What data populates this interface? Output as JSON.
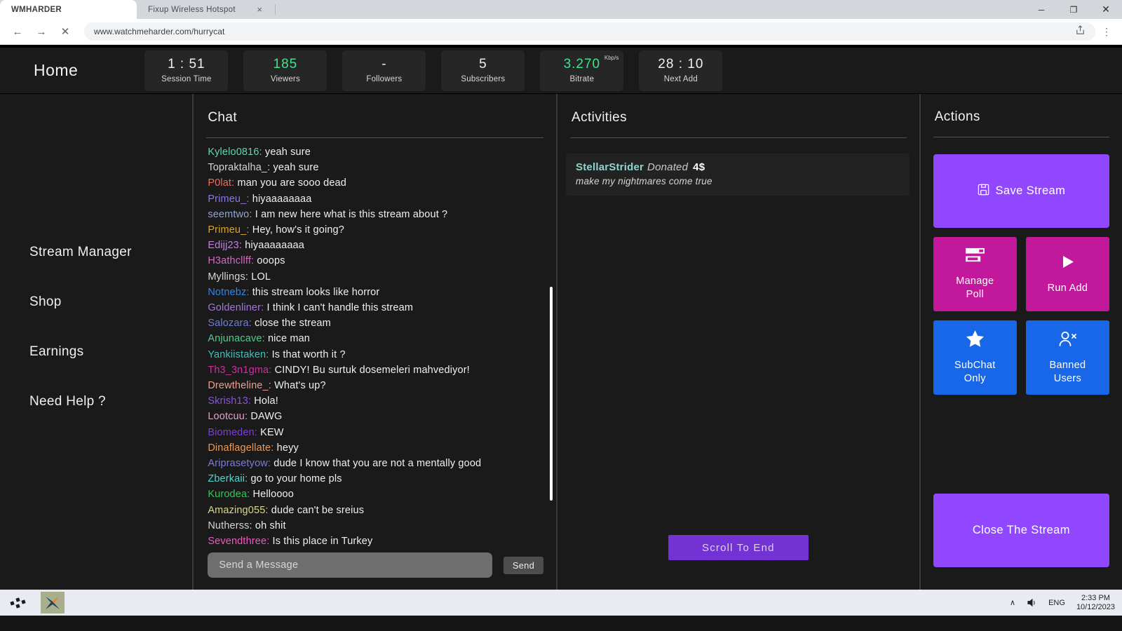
{
  "browser": {
    "tabs": [
      {
        "title": "WMHARDER",
        "active": true,
        "closable": false
      },
      {
        "title": "Fixup Wireless Hotspot",
        "active": false,
        "closable": true,
        "close_label": "×"
      }
    ],
    "window_controls": {
      "minimize": "─",
      "maximize": "❐",
      "close": "✕"
    },
    "nav": {
      "back": "←",
      "forward": "→",
      "stop": "✕"
    },
    "url": "www.watchmeharder.com/hurrycat",
    "omni_share_icon": "share-icon",
    "menu_icon": "⋮"
  },
  "header": {
    "title": "Home",
    "stats": [
      {
        "value": "1 : 51",
        "label": "Session Time",
        "unit": "",
        "green": false
      },
      {
        "value": "185",
        "label": "Viewers",
        "unit": "",
        "green": true
      },
      {
        "value": "-",
        "label": "Followers",
        "unit": "",
        "green": false
      },
      {
        "value": "5",
        "label": "Subscribers",
        "unit": "",
        "green": false
      },
      {
        "value": "3.270",
        "label": "Bitrate",
        "unit": "Kbp/s",
        "green": true
      },
      {
        "value": "28 : 10",
        "label": "Next Add",
        "unit": "",
        "green": false
      }
    ]
  },
  "sidebar": {
    "items": [
      {
        "label": "Stream Manager"
      },
      {
        "label": "Shop"
      },
      {
        "label": "Earnings"
      },
      {
        "label": "Need Help ?"
      }
    ]
  },
  "chat": {
    "title": "Chat",
    "messages": [
      {
        "user": "Kylelo0816",
        "color": "#62d6a8",
        "text": "yeah sure"
      },
      {
        "user": "Topraktalha_",
        "color": "#d5d5d5",
        "text": "yeah sure"
      },
      {
        "user": "P0lat",
        "color": "#e8705c",
        "text": "man you are sooo dead"
      },
      {
        "user": "Primeu_",
        "color": "#8a7ae0",
        "text": "hiyaaaaaaaa"
      },
      {
        "user": "seemtwo",
        "color": "#8fa6d4",
        "text": "I am new here what is this stream about ?"
      },
      {
        "user": "Primeu_",
        "color": "#d7a52e",
        "text": "Hey, how's it going?"
      },
      {
        "user": "Edijj23",
        "color": "#c281e0",
        "text": "hiyaaaaaaaa"
      },
      {
        "user": "H3athcllff",
        "color": "#d667c5",
        "text": "ooops"
      },
      {
        "user": "Myllings",
        "color": "#d5d5d5",
        "text": "LOL"
      },
      {
        "user": "Notnebz",
        "color": "#2f86e8",
        "text": "this stream looks like horror"
      },
      {
        "user": "Goldenliner",
        "color": "#a379d8",
        "text": "I think I can't handle this stream"
      },
      {
        "user": "Salozara",
        "color": "#6f7ed6",
        "text": "close the stream"
      },
      {
        "user": "Anjunacave",
        "color": "#56c98d",
        "text": "nice man"
      },
      {
        "user": "Yankiistaken",
        "color": "#3cc4b8",
        "text": "Is that worth it ?"
      },
      {
        "user": "Th3_3n1gma",
        "color": "#cd2f9e",
        "text": "CINDY! Bu surtuk dosemeleri mahvediyor!"
      },
      {
        "user": "Drewtheline_",
        "color": "#e8a294",
        "text": "What's up?"
      },
      {
        "user": "Skrish13",
        "color": "#8a52e0",
        "text": "Hola!"
      },
      {
        "user": "Lootcuu",
        "color": "#e0a3c8",
        "text": " DAWG"
      },
      {
        "user": "Biomeden",
        "color": "#7b3fd4",
        "text": "KEW"
      },
      {
        "user": "Dinaflagellate",
        "color": "#e89a5c",
        "text": "heyy"
      },
      {
        "user": "Ariprasetyow",
        "color": "#7d7ad8",
        "text": "dude I know that you are not a mentally good"
      },
      {
        "user": "Zberkaii",
        "color": "#4fd6ce",
        "text": "go to your home pls"
      },
      {
        "user": "Kurodea",
        "color": "#35c65c",
        "text": "Helloooo"
      },
      {
        "user": "Amazing055",
        "color": "#dbd98a",
        "text": "dude can't be sreius"
      },
      {
        "user": "Nutherss",
        "color": "#d5d5d5",
        "text": "oh shit"
      },
      {
        "user": "Sevendthree",
        "color": "#e85cc0",
        "text": "Is this place in Turkey"
      }
    ],
    "input_placeholder": "Send a Message",
    "input_value": "",
    "send_label": "Send"
  },
  "activities": {
    "title": "Activities",
    "items": [
      {
        "user": "StellarStrider",
        "verb": "Donated",
        "amount": "4$",
        "message": "make my nightmares come true"
      }
    ],
    "scroll_to_end_label": "Scroll To End"
  },
  "actions": {
    "title": "Actions",
    "save_stream": {
      "label": "Save Stream",
      "icon": "save-disk-icon",
      "color": "#9147ff"
    },
    "tiles": [
      {
        "label": "Manage\nPoll",
        "line1": "Manage",
        "line2": "Poll",
        "icon": "poll-bars-icon",
        "color": "#c2199c"
      },
      {
        "label": "Run Add",
        "line1": "Run Add",
        "line2": "",
        "icon": "play-icon",
        "color": "#c2199c"
      },
      {
        "label": "SubChat\nOnly",
        "line1": "SubChat",
        "line2": "Only",
        "icon": "star-icon",
        "color": "#1767e8"
      },
      {
        "label": "Banned\nUsers",
        "line1": "Banned",
        "line2": "Users",
        "icon": "user-remove-icon",
        "color": "#1767e8"
      }
    ],
    "close_stream_label": "Close The Stream"
  },
  "taskbar": {
    "apps": [
      {
        "name": "task-view-icon"
      },
      {
        "name": "stream-app-icon"
      }
    ],
    "tray": {
      "chevron": "∧",
      "volume": "volume-icon",
      "language": "ENG",
      "time": "2:33 PM",
      "date": "10/12/2023"
    }
  }
}
